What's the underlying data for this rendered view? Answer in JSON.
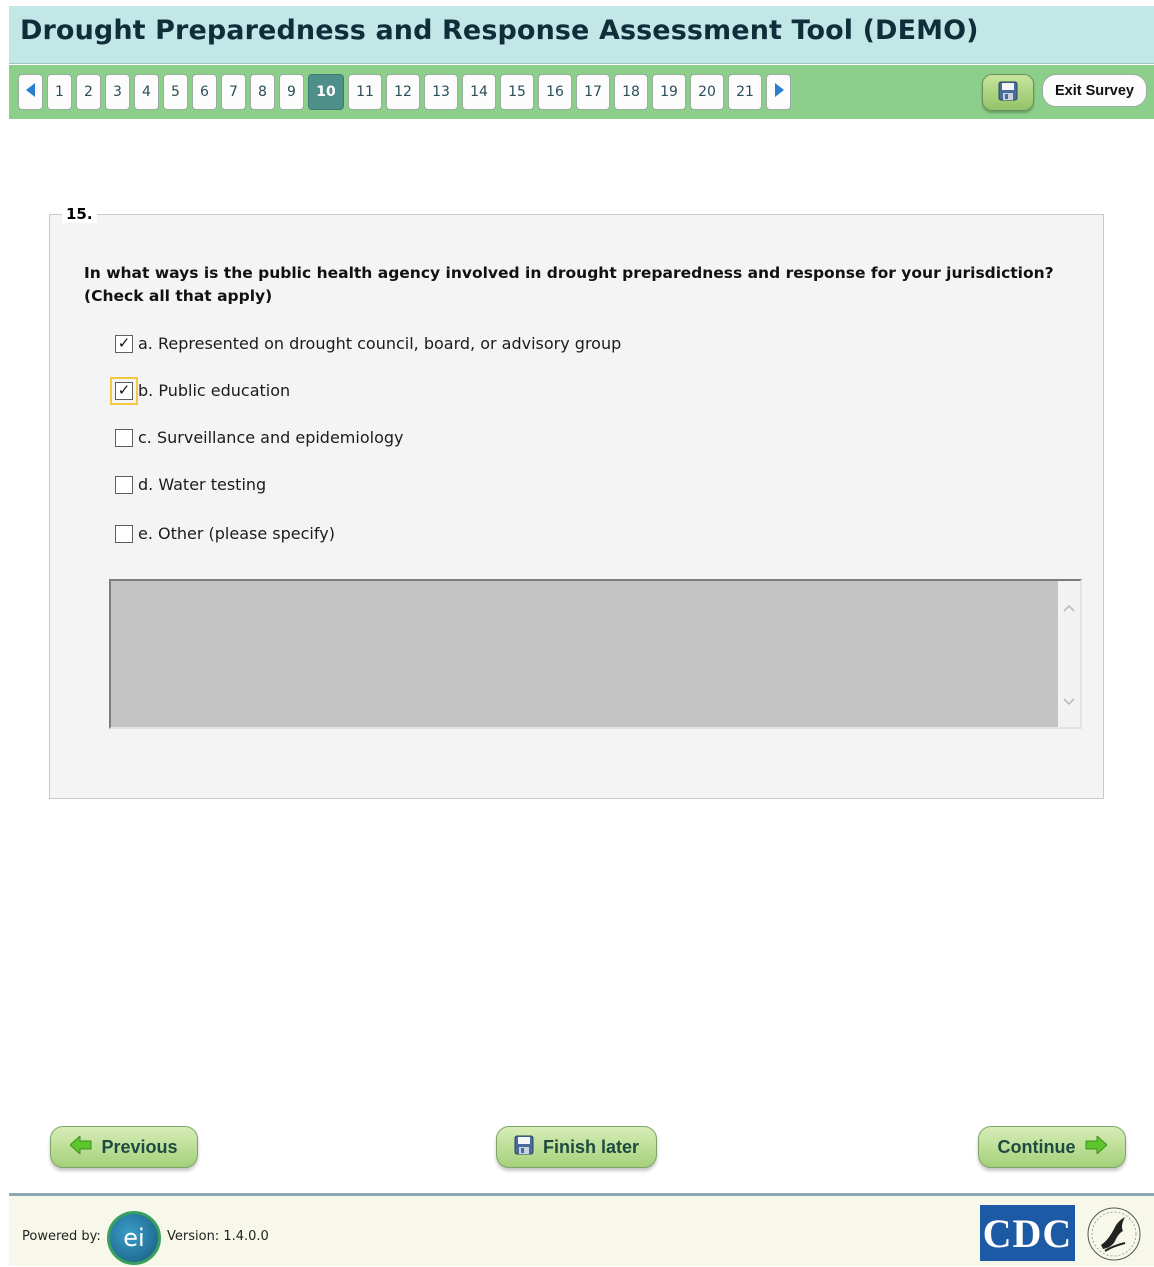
{
  "header": {
    "title": "Drought Preparedness and Response Assessment Tool (DEMO)"
  },
  "nav": {
    "pages": [
      "1",
      "2",
      "3",
      "4",
      "5",
      "6",
      "7",
      "8",
      "9",
      "10",
      "11",
      "12",
      "13",
      "14",
      "15",
      "16",
      "17",
      "18",
      "19",
      "20",
      "21"
    ],
    "current_page": "10",
    "exit_label": "Exit Survey",
    "prev_icon": "left-triangle-icon",
    "next_icon": "right-triangle-icon",
    "save_icon": "floppy-disk-icon"
  },
  "question": {
    "number": "15.",
    "text_line1": "In what ways is the public health agency involved in drought preparedness and response for your jurisdiction?",
    "text_line2": "(Check all that apply)",
    "options": [
      {
        "label": "a. Represented on drought council, board, or advisory group",
        "checked": true
      },
      {
        "label": "b. Public education",
        "checked": true,
        "focused": true
      },
      {
        "label": "c. Surveillance and epidemiology",
        "checked": false
      },
      {
        "label": "d. Water testing",
        "checked": false
      },
      {
        "label": "e. Other (please specify)",
        "checked": false
      }
    ],
    "other_value": ""
  },
  "buttons": {
    "previous": "Previous",
    "finish_later": "Finish later",
    "continue": "Continue"
  },
  "footer": {
    "powered_by": "Powered by:",
    "ei_logo_text": "ei",
    "version": "Version: 1.4.0.0",
    "cdc_logo_text": "CDC"
  },
  "colors": {
    "header_bg": "#c3e6e7",
    "nav_bg": "#8bcf8a",
    "current_page_bg": "#4f8f89",
    "button_green": "#a4d17a",
    "focus_outline": "#f5c842"
  }
}
